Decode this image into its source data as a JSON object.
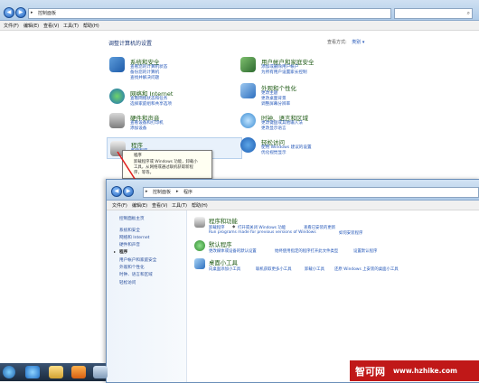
{
  "back_window": {
    "breadcrumb": [
      "控制面板"
    ],
    "menu": [
      "文件(F)",
      "编辑(E)",
      "查看(V)",
      "工具(T)",
      "帮助(H)"
    ],
    "heading": "调整计算机的设置",
    "view_by_label": "查看方式:",
    "view_by_value": "类别 ▾",
    "categories": [
      {
        "title": "系统和安全",
        "links": [
          "查看您的计算机状态",
          "备份您的计算机",
          "查找并解决问题"
        ],
        "color": "#3b7ec4"
      },
      {
        "title": "网络和 Internet",
        "links": [
          "查看网络状态和任务",
          "选择家庭组和共享选项"
        ],
        "color": "#2f9a3e"
      },
      {
        "title": "硬件和声音",
        "links": [
          "查看设备和打印机",
          "添加设备"
        ],
        "color": "#7d7d7d"
      },
      {
        "title": "程序",
        "links": [
          "卸载程序"
        ],
        "color": "#8a8a8a"
      },
      {
        "title": "用户帐户和家庭安全",
        "links": [
          "添加或删除用户帐户",
          "为所有用户设置家长控制"
        ],
        "color": "#3c7c3a"
      },
      {
        "title": "外观和个性化",
        "links": [
          "更改主题",
          "更改桌面背景",
          "调整屏幕分辨率"
        ],
        "color": "#2d6fbf"
      },
      {
        "title": "时钟、语言和区域",
        "links": [
          "更改键盘或其他输入法",
          "更改显示语言"
        ],
        "color": "#3a8bd1"
      },
      {
        "title": "轻松访问",
        "links": [
          "使用 Windows 建议的设置",
          "优化视觉显示"
        ],
        "color": "#1f5fb5"
      }
    ],
    "tooltip_lines": [
      "程序",
      "卸载程序或 Windows 功能，卸载小",
      "工具，从网络或通过联机获取新程",
      "序，等等。"
    ]
  },
  "front_window": {
    "breadcrumb": [
      "控制面板",
      "程序"
    ],
    "menu": [
      "文件(F)",
      "编辑(E)",
      "查看(V)",
      "工具(T)",
      "帮助(H)"
    ],
    "sidebar": [
      "控制面板主页",
      "系统和安全",
      "网络和 Internet",
      "硬件和声音",
      "程序",
      "用户帐户和家庭安全",
      "外观和个性化",
      "时钟、语言和区域",
      "轻松访问"
    ],
    "sections": [
      {
        "title": "程序和功能",
        "links": [
          "卸载程序",
          "打开或关闭 Windows 功能",
          "查看已安装的更新"
        ],
        "links2": [
          "Run programs made for previous versions of Windows",
          "如何安装程序"
        ],
        "color": "#8b8b8b"
      },
      {
        "title": "默认程序",
        "links": [
          "更改媒体或设备的默认设置",
          "始终使用指定的程序打开此文件类型",
          "设置默认程序"
        ],
        "links2": [],
        "color": "#3ba03b"
      },
      {
        "title": "桌面小工具",
        "links": [
          "向桌面添加小工具",
          "联机获取更多小工具",
          "卸载小工具",
          "还原 Windows 上安装的桌面小工具"
        ],
        "links2": [],
        "color": "#2d6fbf"
      }
    ]
  },
  "watermark": {
    "brand": "智可网",
    "url": "www.hzhike.com"
  },
  "colors": {
    "link": "#2356b8",
    "category_title": "#1e5a14",
    "arrow": "#e01b1b"
  }
}
